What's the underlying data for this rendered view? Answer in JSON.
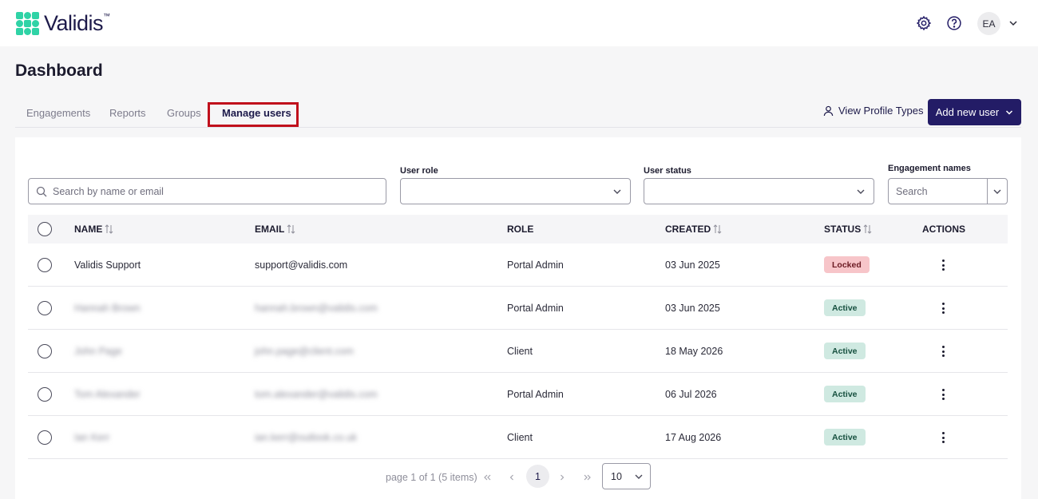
{
  "brand": {
    "name": "Validis",
    "trademark": "™",
    "accent": "#2fd3a6",
    "primary": "#231c66"
  },
  "header": {
    "settings_icon": "gear-icon",
    "help_icon": "help-circle-icon",
    "avatar_initials": "EA"
  },
  "page": {
    "title": "Dashboard"
  },
  "tabs": [
    {
      "label": "Engagements",
      "active": false
    },
    {
      "label": "Reports",
      "active": false
    },
    {
      "label": "Groups",
      "active": false
    },
    {
      "label": "Manage users",
      "active": true
    }
  ],
  "actions": {
    "view_profile_types": "View Profile Types",
    "add_new_user": "Add new user"
  },
  "filters": {
    "search_placeholder": "Search by name or email",
    "user_role_label": "User role",
    "user_role_value": "",
    "user_status_label": "User status",
    "user_status_value": "",
    "engagement_names_label": "Engagement names",
    "engagement_names_placeholder": "Search"
  },
  "table": {
    "columns": [
      "NAME",
      "EMAIL",
      "ROLE",
      "CREATED",
      "STATUS",
      "ACTIONS"
    ],
    "rows": [
      {
        "name": "Validis Support",
        "email": "support@validis.com",
        "role": "Portal Admin",
        "created": "03 Jun 2025",
        "status": "Locked",
        "blurred": false
      },
      {
        "name": "Hannah Brown",
        "email": "hannah.brown@validis.com",
        "role": "Portal Admin",
        "created": "03 Jun 2025",
        "status": "Active",
        "blurred": true
      },
      {
        "name": "John Page",
        "email": "john.page@client.com",
        "role": "Client",
        "created": "18 May 2026",
        "status": "Active",
        "blurred": true
      },
      {
        "name": "Tom Alexander",
        "email": "tom.alexander@validis.com",
        "role": "Portal Admin",
        "created": "06 Jul 2026",
        "status": "Active",
        "blurred": true
      },
      {
        "name": "Ian Kerr",
        "email": "ian.kerr@outlook.co.uk",
        "role": "Client",
        "created": "17 Aug 2026",
        "status": "Active",
        "blurred": true
      }
    ]
  },
  "pagination": {
    "summary": "page 1 of 1 (5 items)",
    "current_page": "1",
    "page_size": "10"
  }
}
